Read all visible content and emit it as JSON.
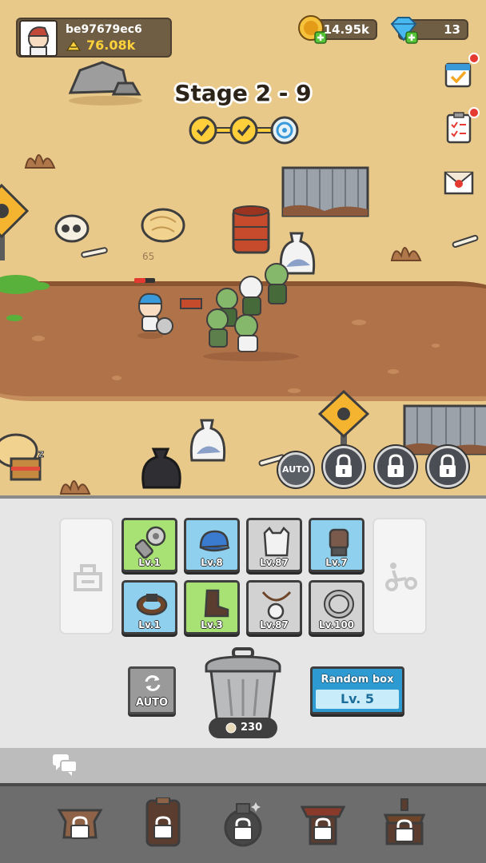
{
  "player": {
    "id": "be97679ec6",
    "power": "76.08k"
  },
  "currency": {
    "gold": "14.95k",
    "gems": "13"
  },
  "stage": {
    "title": "Stage 2 - 9",
    "progress": [
      "done",
      "done",
      "current"
    ]
  },
  "scene": {
    "auto_label": "AUTO",
    "enemy_hp_text": "65"
  },
  "equipment": {
    "row1": [
      {
        "name": "saw",
        "level": "Lv.1",
        "grade": "green"
      },
      {
        "name": "cap",
        "level": "Lv.8",
        "grade": "blue"
      },
      {
        "name": "shirt",
        "level": "Lv.87",
        "grade": "gray"
      },
      {
        "name": "glove",
        "level": "Lv.7",
        "grade": "blue"
      }
    ],
    "row2": [
      {
        "name": "belt",
        "level": "Lv.1",
        "grade": "blue"
      },
      {
        "name": "boot",
        "level": "Lv.3",
        "grade": "green"
      },
      {
        "name": "necklace",
        "level": "Lv.87",
        "grade": "gray"
      },
      {
        "name": "ring",
        "level": "Lv.100",
        "grade": "gray"
      }
    ]
  },
  "actions": {
    "auto_label": "AUTO",
    "trash_count": "230",
    "random_box_title": "Random box",
    "random_box_level": "Lv. 5"
  },
  "colors": {
    "sand": "#e8c98a",
    "road": "#b07249",
    "green_grade": "#a8e275",
    "blue_grade": "#8fd0ef",
    "gray_grade": "#d2d2d2"
  },
  "icons": [
    "gold-icon",
    "gem-icon",
    "calendar-icon",
    "quest-icon",
    "mail-icon",
    "lock-icon",
    "chat-icon",
    "trash-can-icon"
  ]
}
